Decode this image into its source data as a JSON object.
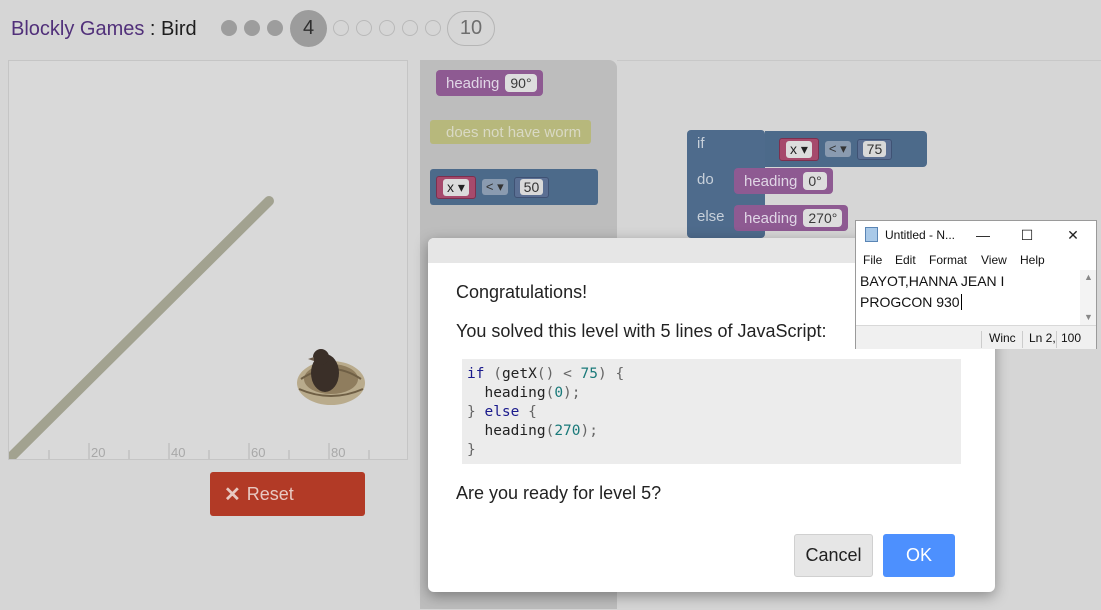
{
  "header": {
    "app_link": "Blockly Games",
    "separator": " : ",
    "game": "Bird",
    "current_level": "4",
    "last_level": "10"
  },
  "canvas": {
    "x_ticks": [
      "20",
      "40",
      "60",
      "80"
    ]
  },
  "reset_button": {
    "icon": "close-icon",
    "label": "Reset",
    "color": "#b23a26"
  },
  "flyout": {
    "heading_block": {
      "label": "heading",
      "value": "90°"
    },
    "worm_block": {
      "label": "does not have worm"
    },
    "compare_block": {
      "var": "x",
      "op": "<",
      "value": "50"
    }
  },
  "workspace": {
    "if_label": "if",
    "do_label": "do",
    "else_label": "else",
    "condition": {
      "var": "x",
      "op": "<",
      "value": "75"
    },
    "do_heading": {
      "label": "heading",
      "value": "0°"
    },
    "else_heading": {
      "label": "heading",
      "value": "270°"
    }
  },
  "dialog": {
    "title": "Congratulations!",
    "message": "You solved this level with 5 lines of JavaScript:",
    "question": "Are you ready for level 5?",
    "cancel_label": "Cancel",
    "ok_label": "OK",
    "ok_color": "#4d90fe",
    "code": {
      "if_kw": "if",
      "fn_getx": "getX",
      "lt": "<",
      "n75": "75",
      "fn_heading": "heading",
      "n0": "0",
      "else_kw": "else",
      "n270": "270"
    }
  },
  "notepad": {
    "title": "Untitled - N...",
    "menu": [
      "File",
      "Edit",
      "Format",
      "View",
      "Help"
    ],
    "lines": [
      "BAYOT,HANNA JEAN I",
      "PROGCON 930"
    ],
    "status_encoding": "Winc",
    "status_pos": "Ln 2,",
    "status_zoom": "100"
  }
}
